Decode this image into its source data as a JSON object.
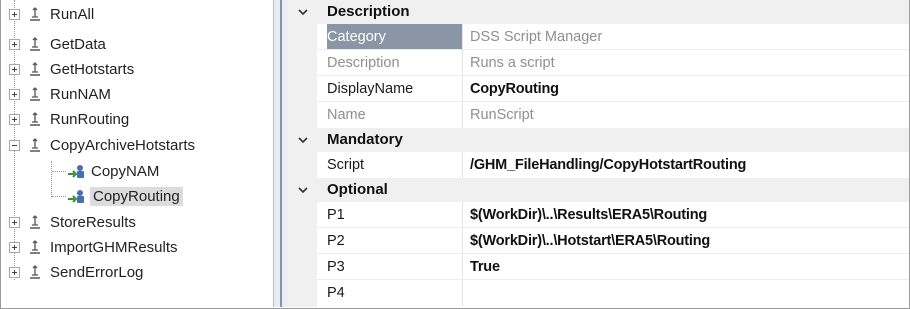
{
  "tree": {
    "items": [
      {
        "label": "RunAll",
        "expander": "plus"
      },
      {
        "label": "GetData",
        "expander": "plus"
      },
      {
        "label": "GetHotstarts",
        "expander": "plus"
      },
      {
        "label": "RunNAM",
        "expander": "plus"
      },
      {
        "label": "RunRouting",
        "expander": "plus"
      },
      {
        "label": "CopyArchiveHotstarts",
        "expander": "minus"
      },
      {
        "label": "StoreResults",
        "expander": "plus"
      },
      {
        "label": "ImportGHMResults",
        "expander": "plus"
      },
      {
        "label": "SendErrorLog",
        "expander": "plus"
      }
    ],
    "children": [
      {
        "label": "CopyNAM",
        "selected": false
      },
      {
        "label": "CopyRouting",
        "selected": true
      }
    ]
  },
  "grid": {
    "categories": {
      "description": "Description",
      "mandatory": "Mandatory",
      "optional": "Optional"
    },
    "properties": {
      "category": {
        "name": "Category",
        "value": "DSS Script Manager"
      },
      "description": {
        "name": "Description",
        "value": "Runs a script"
      },
      "displayname": {
        "name": "DisplayName",
        "value": "CopyRouting"
      },
      "name": {
        "name": "Name",
        "value": "RunScript"
      },
      "script": {
        "name": "Script",
        "value": "/GHM_FileHandling/CopyHotstartRouting"
      },
      "p1": {
        "name": "P1",
        "value": "$(WorkDir)\\..\\Results\\ERA5\\Routing"
      },
      "p2": {
        "name": "P2",
        "value": "$(WorkDir)\\..\\Hotstart\\ERA5\\Routing"
      },
      "p3": {
        "name": "P3",
        "value": "True"
      },
      "p4": {
        "name": "P4",
        "value": ""
      }
    }
  },
  "colors": {
    "selected_name_bg": "#8a95a6",
    "category_bg": "#f0f0f0",
    "splitter": "#7f93b3",
    "tree_selected_bg": "#dcdcdc"
  },
  "icons": {
    "tree_item": "script-file-icon",
    "tree_child": "script-action-icon",
    "category": "chevron-down-icon"
  }
}
